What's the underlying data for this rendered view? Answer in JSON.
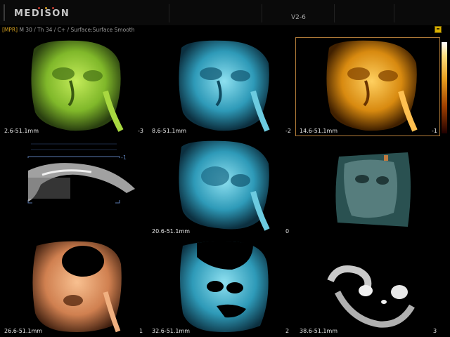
{
  "header": {
    "brand": "MEDISON",
    "brand_dot_colors": [
      "#c43a2e",
      "#d6a020",
      "#c43a2e"
    ],
    "probe": "V2-6"
  },
  "info_bar": {
    "tag": "[MPR]",
    "params": " M 30 / Th 34 / C+ / Surface:Surface Smooth"
  },
  "slices": [
    {
      "range": "2.6-51.1mm",
      "index": "-3",
      "color": "#9ed23a"
    },
    {
      "range": "8.6-51.1mm",
      "index": "-2",
      "color": "#3fb3cf"
    },
    {
      "range": "14.6-51.1mm",
      "index": "-1",
      "color": "#e8a020"
    },
    {
      "range": "",
      "index": "-1",
      "color": "#cfcfcf"
    },
    {
      "range": "20.6-51.1mm",
      "index": "0",
      "color": "#3fb3cf"
    },
    {
      "range": "",
      "index": "",
      "color": "#4f7f7f"
    },
    {
      "range": "26.6-51.1mm",
      "index": "1",
      "color": "#e8a070"
    },
    {
      "range": "32.6-51.1mm",
      "index": "2",
      "color": "#3fb3cf"
    },
    {
      "range": "38.6-51.1mm",
      "index": "3",
      "color": "#d8d8d8"
    }
  ]
}
